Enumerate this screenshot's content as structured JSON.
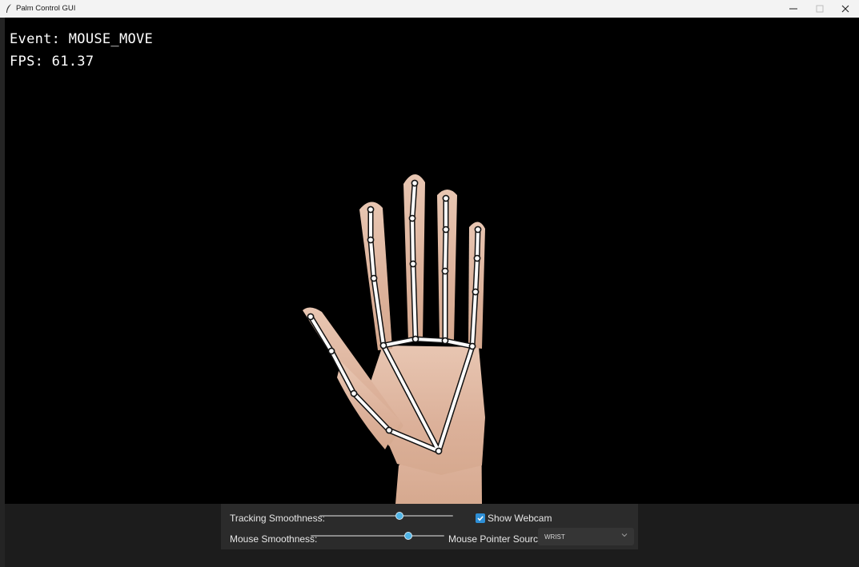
{
  "window": {
    "title": "Palm Control GUI"
  },
  "overlay": {
    "event_text": "Event: MOUSE_MOVE",
    "fps_text": "FPS: 61.37"
  },
  "controls": {
    "tracking_label": "Tracking Smoothness:",
    "tracking_value": 0.6,
    "show_webcam_label": "Show Webcam",
    "show_webcam_checked": true,
    "mouse_label": "Mouse Smoothness:",
    "mouse_value": 0.73,
    "pointer_source_label": "Mouse Pointer Source:",
    "pointer_source_value": "WRIST"
  },
  "icons": [
    "app-feather-icon",
    "minimize-icon",
    "maximize-icon",
    "close-icon",
    "checkmark-icon",
    "chevron-down-icon"
  ],
  "colors": {
    "accent": "#4fb4e6",
    "checkbox": "#2e8fd6",
    "panel": "#2b2b2b",
    "viewport": "#000000"
  }
}
